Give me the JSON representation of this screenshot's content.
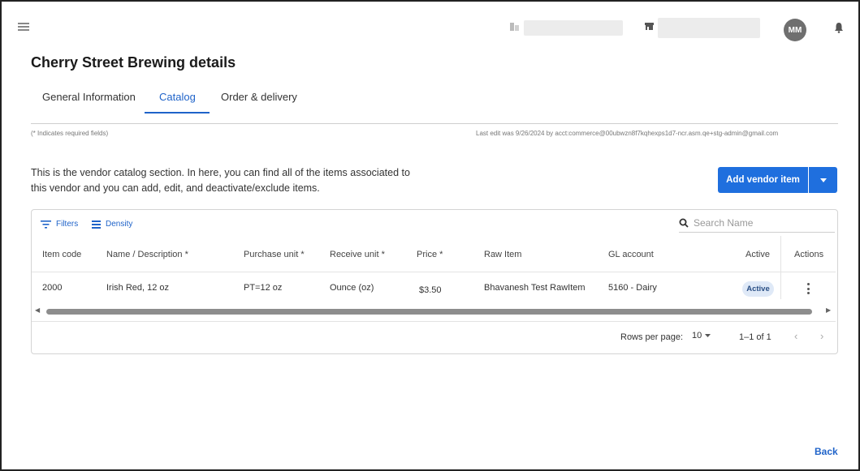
{
  "header": {
    "user_initials": "MM"
  },
  "page": {
    "title": "Cherry Street Brewing details",
    "required_note": "(* Indicates required fields)",
    "last_edit": "Last edit was 9/26/2024 by acct:commerce@00ubwzn8f7kqhexps1d7-ncr.asm.qe+stg-admin@gmail.com",
    "description": "This is the vendor catalog section. In here, you can find all of the items associated to this vendor and you can add, edit, and deactivate/exclude items.",
    "add_button_label": "Add vendor item",
    "back_label": "Back"
  },
  "tabs": [
    {
      "label": "General Information",
      "active": false
    },
    {
      "label": "Catalog",
      "active": true
    },
    {
      "label": "Order & delivery",
      "active": false
    }
  ],
  "toolbar": {
    "filters_label": "Filters",
    "density_label": "Density",
    "search_placeholder": "Search Name"
  },
  "table": {
    "columns": [
      "Item code",
      "Name / Description *",
      "Purchase unit *",
      "Receive unit *",
      "Price *",
      "Raw Item",
      "GL account",
      "Active",
      "Actions"
    ],
    "rows": [
      {
        "item_code": "2000",
        "name": "Irish Red, 12 oz",
        "purchase_unit": "PT=12 oz",
        "receive_unit": "Ounce (oz)",
        "price": "$3.50",
        "raw_item": "Bhavanesh Test RawItem",
        "gl_account": "5160 - Dairy",
        "active": "Active"
      }
    ]
  },
  "pagination": {
    "rows_per_page_label": "Rows per page:",
    "rows_per_page_value": "10",
    "range": "1–1 of 1"
  },
  "colors": {
    "accent": "#1f63c9",
    "button": "#1f6fde",
    "badge_bg": "#dfe9f7",
    "avatar": "#6f6f6f"
  }
}
